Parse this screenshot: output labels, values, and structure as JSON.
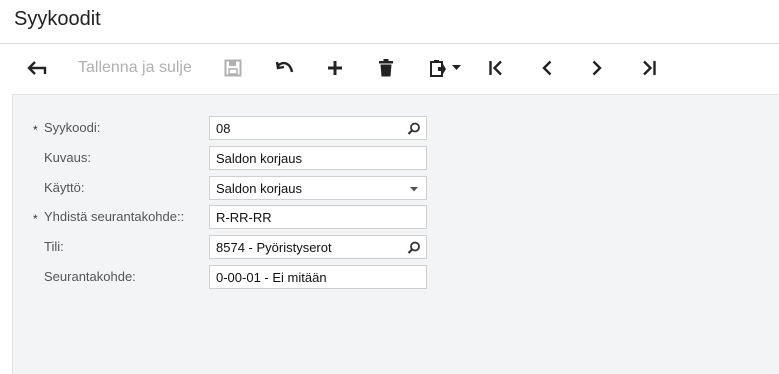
{
  "header": {
    "title": "Syykoodit"
  },
  "toolbar": {
    "save_close_label": "Tallenna ja sulje",
    "icons": [
      "back-arrow-icon",
      "save-icon",
      "undo-icon",
      "add-icon",
      "delete-icon",
      "copy-paste-icon",
      "chevron-down-icon",
      "first-record-icon",
      "previous-record-icon",
      "next-record-icon",
      "last-record-icon"
    ]
  },
  "form": {
    "required_marker": "*",
    "fields": [
      {
        "label": "Syykoodi:",
        "value": "08",
        "required": true,
        "control": "selector",
        "icon": "search-icon"
      },
      {
        "label": "Kuvaus:",
        "value": "Saldon korjaus",
        "required": false,
        "control": "text"
      },
      {
        "label": "Käyttö:",
        "value": "Saldon korjaus",
        "required": false,
        "control": "dropdown",
        "icon": "dropdown-arrow-icon"
      },
      {
        "label": "Yhdistä seurantakohde::",
        "value": "R-RR-RR",
        "required": true,
        "control": "text"
      },
      {
        "label": "Tili:",
        "value": "8574 - Pyöristyserot",
        "required": false,
        "control": "selector",
        "icon": "search-icon"
      },
      {
        "label": "Seurantakohde:",
        "value": "0-00-01 - Ei mitään",
        "required": false,
        "control": "text"
      }
    ]
  },
  "colors": {
    "content_background": "#f3f4f6",
    "toolbar_icon": "#222222",
    "disabled": "#b0b0b0"
  }
}
